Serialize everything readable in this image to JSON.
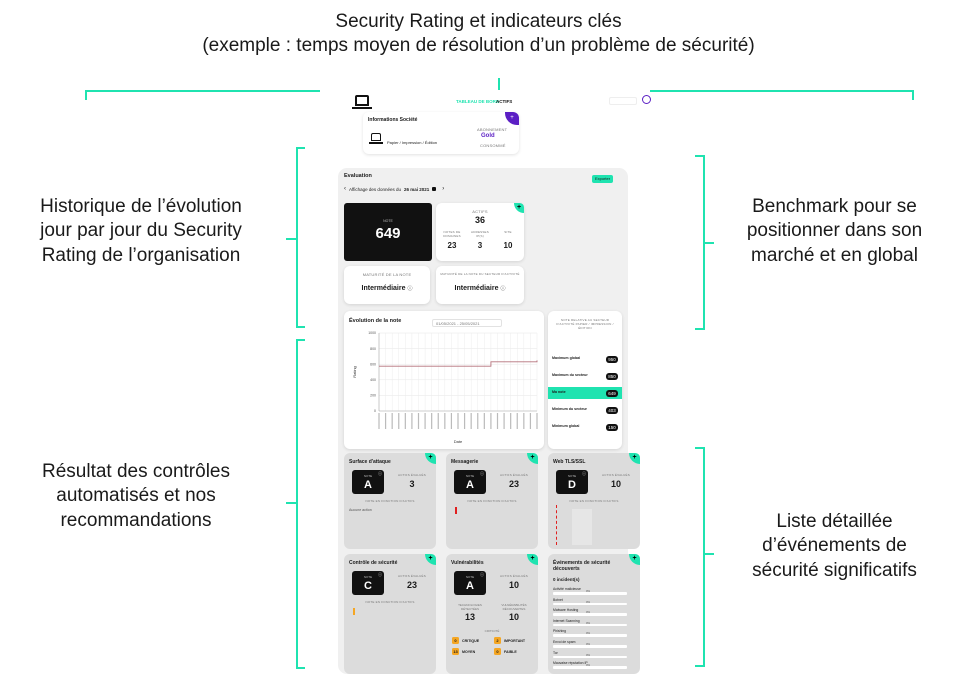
{
  "annotations": {
    "top_line1": "Security Rating et indicateurs clés",
    "top_line2": "(exemple : temps moyen de résolution d’un problème de sécurité)",
    "left1_l1": "Historique de l’évolution",
    "left1_l2": "jour par jour du Security",
    "left1_l3": "Rating de l’organisation",
    "left2_l1": "Résultat des contrôles",
    "left2_l2": "automatisés et nos",
    "left2_l3": "recommandations",
    "right1_l1": "Benchmark pour se",
    "right1_l2": "positionner dans son",
    "right1_l3": "marché et en global",
    "right2_l1": "Liste détaillée",
    "right2_l2": "d’événements de",
    "right2_l3": "sécurité significatifs"
  },
  "colors": {
    "accent": "#1fe3b0",
    "purple": "#5b1fc4",
    "dark": "#111111",
    "bracket": "#1fe3b0",
    "line": "#b5707a",
    "orange": "#f5a623",
    "red": "#e02020"
  },
  "topbar": {
    "nav_dashboard": "TABLEAU DE BORD",
    "nav_assets": "ACTIFS",
    "user_icon": "user-circle-icon"
  },
  "company": {
    "title": "Informations Société",
    "sector": "Papier / Impression / Édition",
    "subscription_label": "ABONNEMENT",
    "plan": "Gold",
    "status": "CONSOMMÉ"
  },
  "evaluation": {
    "title": "Evaluation",
    "export_button": "Exporter",
    "date_prefix": "Affichage des données du",
    "date": "26 mai 2021",
    "score_label": "NOTE",
    "score": "649",
    "assets_label": "ACTIFS",
    "assets_count": "36",
    "stat1_label": "NOTES DE DOMAINES",
    "stat1_value": "23",
    "stat2_label": "ADRESSES IP(S)",
    "stat2_value": "3",
    "stat3_label": "SITE",
    "stat3_value": "10",
    "maturity_label": "MATURITÉ DE LA NOTE",
    "maturity_value": "Intermédiaire",
    "sector_maturity_label": "MATURITÉ DE LA NOTE DU SECTEUR D'ACTIVITÉ",
    "sector_maturity_value": "Intermédiaire"
  },
  "chart_data": {
    "type": "line",
    "title": "Évolution de la note",
    "date_range": "01/05/2021 - 25/05/2021",
    "xlabel": "Date",
    "ylabel": "Rating",
    "ylim": [
      0,
      1000
    ],
    "yticks": [
      "1000",
      "800",
      "600",
      "400",
      "200",
      "0"
    ],
    "series": [
      {
        "x": [
          0,
          1,
          2,
          3,
          4,
          5,
          6,
          7,
          8,
          9,
          10,
          11,
          12,
          13,
          14,
          15,
          16,
          17,
          18,
          19,
          20,
          21,
          22,
          23,
          24
        ],
        "values": [
          575,
          575,
          575,
          575,
          575,
          575,
          575,
          575,
          575,
          575,
          575,
          575,
          575,
          575,
          575,
          575,
          575,
          630,
          630,
          630,
          630,
          630,
          630,
          630,
          649
        ]
      }
    ]
  },
  "benchmark": {
    "header": "NOTE RELATIVE AU SECTEUR D'ACTIVITÉ PAPIER / IMPRESSION / ÉDITION",
    "rows": [
      {
        "label": "Maximum global",
        "value": "950",
        "highlight": false
      },
      {
        "label": "Maximum du secteur",
        "value": "850",
        "highlight": false
      },
      {
        "label": "Ma note",
        "value": "649",
        "highlight": true
      },
      {
        "label": "Minimum du secteur",
        "value": "403",
        "highlight": false
      },
      {
        "label": "Minimum global",
        "value": "150",
        "highlight": false
      }
    ]
  },
  "controls": [
    {
      "title": "Surface d'attaque",
      "grade": "A",
      "count_label": "ACTIFS ÉVALUÉS",
      "count": "3",
      "sub": "NOTE EN FONCTION D'ACTIFS",
      "note": "Aucune action"
    },
    {
      "title": "Messagerie",
      "grade": "A",
      "count_label": "ACTIFS ÉVALUÉS",
      "count": "23",
      "sub": "NOTE EN FONCTION D'ACTIFS",
      "note": ""
    },
    {
      "title": "Web TLS/SSL",
      "grade": "D",
      "count_label": "ACTIFS ÉVALUÉS",
      "count": "10",
      "sub": "NOTE EN FONCTION D'ACTIFS",
      "note": ""
    },
    {
      "title": "Contrôle de sécurité",
      "grade": "C",
      "count_label": "ACTIFS ÉVALUÉS",
      "count": "23",
      "sub": "NOTE EN FONCTION D'ACTIFS",
      "note": ""
    },
    {
      "title": "Vulnérabilités",
      "grade": "A",
      "count_label": "ACTIFS ÉVALUÉS",
      "count": "10",
      "sub": "",
      "note": ""
    }
  ],
  "grade_label": "NOTE",
  "vulns": {
    "tech_label": "TECHNOLOGIES DÉTECTÉES",
    "tech_count": "13",
    "vuln_label": "VULNÉRABILITÉS DÉCOUVERTES",
    "vuln_count": "10",
    "crit_title": "CRITICITÉ",
    "levels": [
      {
        "n": "0",
        "label": "CRITIQUE"
      },
      {
        "n": "2",
        "label": "IMPORTANT"
      },
      {
        "n": "13",
        "label": "MOYEN"
      },
      {
        "n": "0",
        "label": "FAIBLE"
      }
    ]
  },
  "events": {
    "title_l1": "Événements de sécurité",
    "title_l2": "découverts",
    "count": "0 incident(s)",
    "items": [
      {
        "label": "Activité malicieuse",
        "value": "0%"
      },
      {
        "label": "Botnet",
        "value": "0%"
      },
      {
        "label": "Malware Hosting",
        "value": "0%"
      },
      {
        "label": "Internet Scanning",
        "value": "0%"
      },
      {
        "label": "Phishing",
        "value": "0%"
      },
      {
        "label": "Envoi de spam",
        "value": "0%"
      },
      {
        "label": "Tor",
        "value": "0%"
      },
      {
        "label": "Mauvaise réputation IP",
        "value": "0%"
      }
    ]
  }
}
